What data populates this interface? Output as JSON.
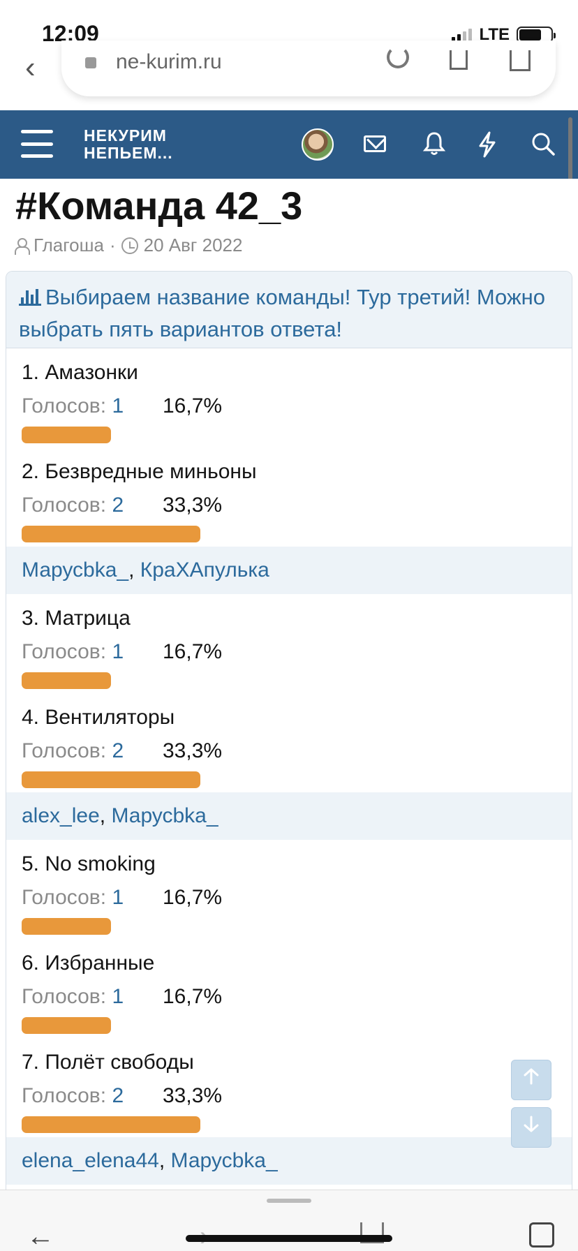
{
  "status": {
    "time": "12:09",
    "network": "LTE"
  },
  "browser": {
    "url": "ne-kurim.ru"
  },
  "site": {
    "logo_line1": "НЕКУРИМ",
    "logo_line2": "НЕПЬЕМ..."
  },
  "thread": {
    "title": "#Команда 42_3",
    "author": "Глагоша",
    "date": "20 Авг 2022"
  },
  "poll": {
    "question": "Выбираем название команды! Тур третий! Можно выбрать пять вариантов ответа!",
    "votes_label": "Голосов:",
    "options": [
      {
        "name": "1. Амазонки",
        "votes": "1",
        "percent": "16,7%",
        "fraction": 0.167
      },
      {
        "name": "2. Безвредные миньоны",
        "votes": "2",
        "percent": "33,3%",
        "fraction": 0.333
      },
      {
        "name": "3. Матрица",
        "votes": "1",
        "percent": "16,7%",
        "fraction": 0.167
      },
      {
        "name": "4. Вентиляторы",
        "votes": "2",
        "percent": "33,3%",
        "fraction": 0.333
      },
      {
        "name": "5. No smoking",
        "votes": "1",
        "percent": "16,7%",
        "fraction": 0.167
      },
      {
        "name": "6. Избранные",
        "votes": "1",
        "percent": "16,7%",
        "fraction": 0.167
      },
      {
        "name": "7. Полёт свободы",
        "votes": "2",
        "percent": "33,3%",
        "fraction": 0.333
      }
    ],
    "voters": [
      [
        "Марусbka_",
        "КраХАпулька"
      ],
      [
        "alex_lee",
        "Марусbka_"
      ],
      [
        "elena_elena44",
        "Марусbka_"
      ]
    ]
  },
  "colors": {
    "header": "#2c5a87",
    "accent": "#2c6a9c",
    "bar": "#e8983b",
    "voters_bg": "#edf3f8"
  }
}
